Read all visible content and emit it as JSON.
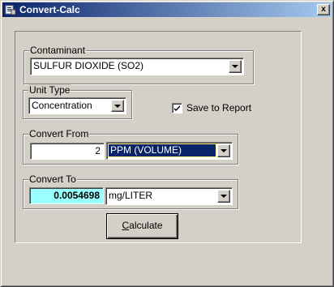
{
  "window": {
    "title": "Convert-Calc",
    "close_glyph": "x"
  },
  "contaminant": {
    "label": "Contaminant",
    "selected": "SULFUR DIOXIDE (SO2)"
  },
  "unit_type": {
    "label": "Unit Type",
    "selected": "Concentration"
  },
  "save_to_report": {
    "label": "Save to Report",
    "checked": true
  },
  "convert_from": {
    "label": "Convert From",
    "value": "2",
    "unit": "PPM (VOLUME)"
  },
  "convert_to": {
    "label": "Convert To",
    "value": "0.0054698",
    "unit": "mg/LITER"
  },
  "calculate_button": {
    "mnemonic": "C",
    "rest": "alculate"
  },
  "colors": {
    "titlebar_start": "#0a246a",
    "titlebar_end": "#a6caf0",
    "result_background": "#99ffff",
    "selection": "#0a246a"
  }
}
